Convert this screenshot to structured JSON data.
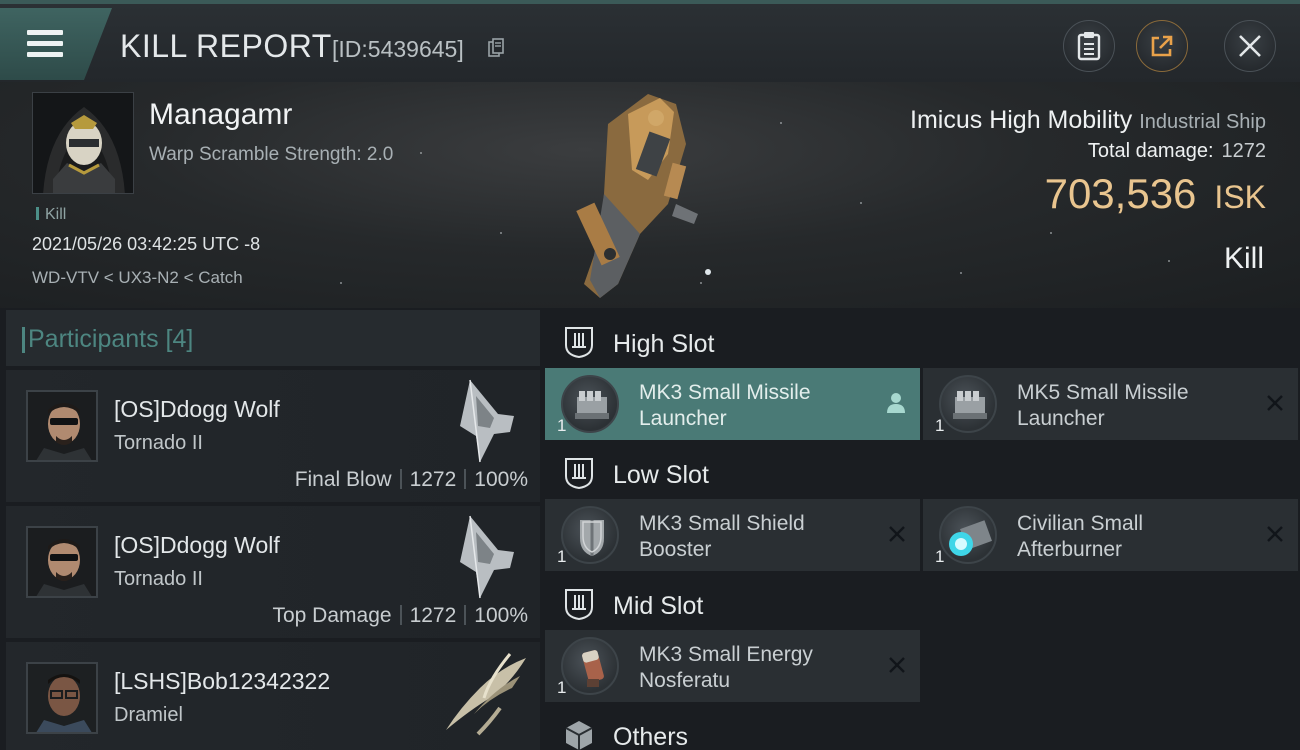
{
  "header": {
    "title": "KILL REPORT",
    "report_id": "[ID:5439645]"
  },
  "victim": {
    "name": "Managamr",
    "warp_scramble": "Warp Scramble Strength: 2.0",
    "tag": "Kill",
    "datetime": "2021/05/26 03:42:25 UTC -8",
    "location": "WD-VTV < UX3-N2 < Catch"
  },
  "ship": {
    "name": "Imicus High Mobility",
    "class": "Industrial Ship",
    "total_damage_label": "Total damage:",
    "total_damage": "1272",
    "isk_value": "703,536",
    "isk_unit": "ISK",
    "result": "Kill"
  },
  "participants": {
    "label": "Participants [4]",
    "rows": [
      {
        "name": "[OS]Ddogg Wolf",
        "ship": "Tornado II",
        "role": "Final Blow",
        "damage": "1272",
        "percent": "100%"
      },
      {
        "name": "[OS]Ddogg Wolf",
        "ship": "Tornado II",
        "role": "Top Damage",
        "damage": "1272",
        "percent": "100%"
      },
      {
        "name": "[LSHS]Bob12342322",
        "ship": "Dramiel"
      }
    ]
  },
  "fitting": {
    "high_slot": {
      "label": "High Slot",
      "modules": [
        {
          "name": "MK3 Small Missile Launcher",
          "qty": "1"
        },
        {
          "name": "MK5 Small Missile Launcher",
          "qty": "1"
        }
      ]
    },
    "low_slot": {
      "label": "Low Slot",
      "modules": [
        {
          "name": "MK3 Small Shield Booster",
          "qty": "1"
        },
        {
          "name": "Civilian Small Afterburner",
          "qty": "1"
        }
      ]
    },
    "mid_slot": {
      "label": "Mid Slot",
      "modules": [
        {
          "name": "MK3 Small Energy Nosferatu",
          "qty": "1"
        }
      ]
    },
    "others": {
      "label": "Others"
    }
  },
  "colors": {
    "accent_teal": "#4d8681",
    "active_module": "#4a7a76",
    "isk_gold": "#e9c58f"
  },
  "icons": [
    "menu-icon",
    "copy-icon",
    "clipboard-icon",
    "share-icon",
    "close-icon",
    "shield-slot-icon",
    "cube-icon",
    "person-icon",
    "remove-icon"
  ]
}
